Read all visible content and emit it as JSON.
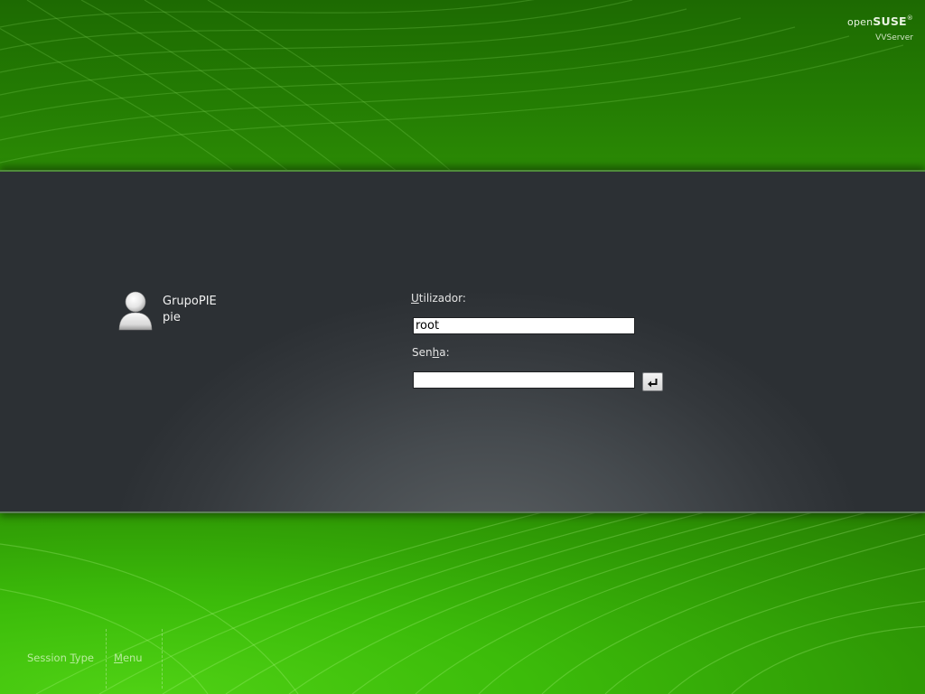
{
  "brand": {
    "logo_prefix": "open",
    "logo_main": "SUSE",
    "logo_mark": "®",
    "subtitle": "VVServer"
  },
  "user_list": {
    "items": [
      {
        "name": "GrupoPIE",
        "login": "pie",
        "icon": "user-avatar-icon"
      }
    ]
  },
  "login_form": {
    "username_label_accel": "U",
    "username_label_rest": "tilizador:",
    "username_value": "root",
    "password_label_pre": "Sen",
    "password_label_accel": "h",
    "password_label_rest": "a:",
    "password_value": "",
    "submit_icon": "enter-return-icon"
  },
  "bottom_bar": {
    "session_type_pre": "Session ",
    "session_type_accel": "T",
    "session_type_rest": "ype",
    "menu_accel": "M",
    "menu_rest": "enu"
  },
  "colors": {
    "background_green": "#2d8a06",
    "panel_gray": "#464b4f",
    "bottom_text": "#b9ec9f"
  }
}
